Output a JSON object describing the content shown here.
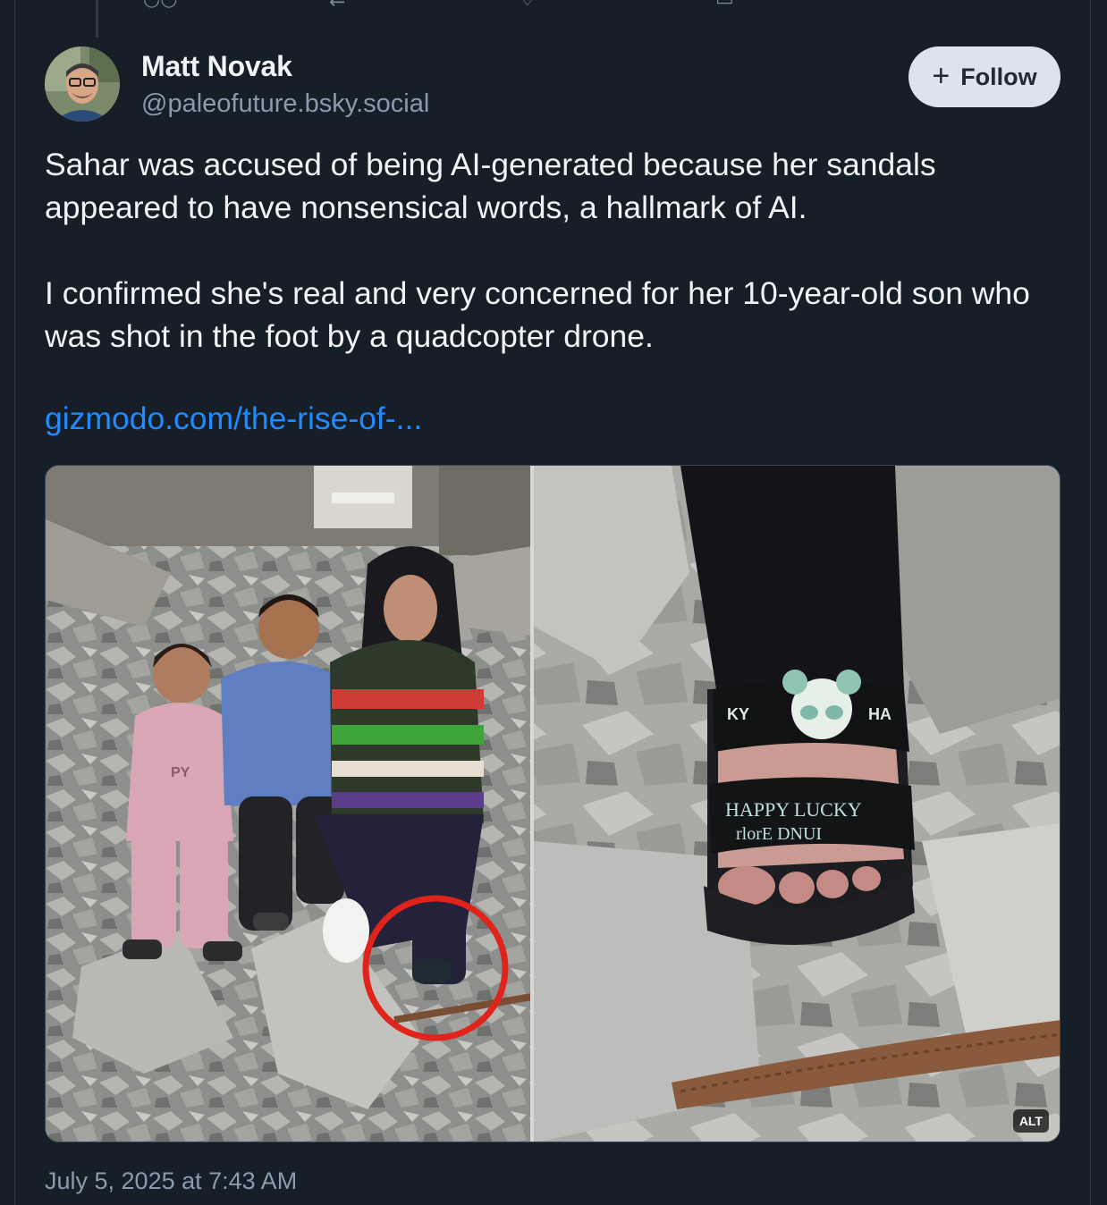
{
  "post": {
    "author_name": "Matt Novak",
    "author_handle": "@paleofuture.bsky.social",
    "follow_label": "Follow",
    "paragraphs": [
      "Sahar was accused of being AI-generated because her sandals appeared to have nonsensical words, a hallmark of AI.",
      "I confirmed she's real and very concerned for her 10-year-old son who was shot in the foot by a quadcopter drone."
    ],
    "link_text": "gizmodo.com/the-rise-of-...",
    "image_alt_badge": "ALT",
    "timestamp": "July 5, 2025 at 7:43 AM"
  },
  "image_text": {
    "sandal_line1": "HAPPY LUCKY",
    "sandal_line2": "rlorE DNUI",
    "sandal_top_left": "KY",
    "sandal_top_right": "HA",
    "hoodie_text": "PY"
  },
  "colors": {
    "background": "#161e27",
    "link": "#208bfe",
    "follow_bg": "#dbe3ec",
    "circle_highlight": "#e0241b"
  },
  "icons": [
    "reply-icon",
    "repost-icon",
    "like-icon",
    "more-icon",
    "plus-icon"
  ]
}
